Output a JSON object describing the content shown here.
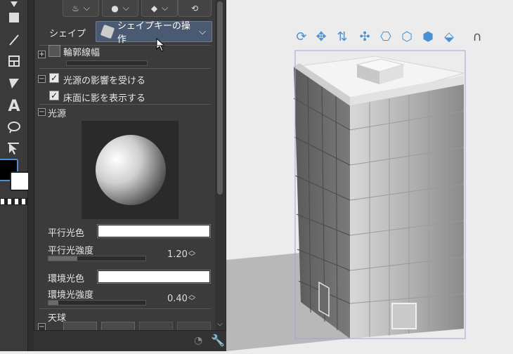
{
  "panel": {
    "shape_label": "シェイプ",
    "shape_dropdown": "シェイプキーの操作",
    "outline_width_label": "輪郭線幅",
    "light_influence_label": "光源の影響を受ける",
    "floor_shadow_label": "床面に影を表示する",
    "light_source_label": "光源",
    "parallel_light_color_label": "平行光色",
    "parallel_light_intensity_label": "平行光強度",
    "parallel_light_intensity_value": "1.20",
    "ambient_light_color_label": "環境光色",
    "ambient_light_intensity_label": "環境光強度",
    "ambient_light_intensity_value": "0.40",
    "sky_label": "天球",
    "light_influence_checked": true,
    "floor_shadow_checked": true,
    "parallel_light_intensity_fraction": 0.3,
    "ambient_light_intensity_fraction": 0.1
  },
  "colors": {
    "panel_bg": "#3b3b3b",
    "dropdown_bg": "#4b5a73",
    "accent_blue": "#4b90d6",
    "canvas_bg": "#ececec",
    "selection_box": "#9aa6d8",
    "main_color": "#000000",
    "sub_color": "#ffffff"
  },
  "icons": {
    "tools": [
      "fill-icon",
      "rectangle-icon",
      "line-icon",
      "frame-icon",
      "correct-line-icon",
      "text-icon",
      "lasso-icon",
      "object-select-icon"
    ],
    "view_controls": [
      "rotate-camera-icon",
      "pan-camera-icon",
      "move-camera-icon",
      "move-object-icon",
      "rotate-object-icon",
      "rotate-object-view-icon",
      "rotate-object-plane-icon",
      "scale-object-icon",
      "magnet-icon"
    ]
  }
}
